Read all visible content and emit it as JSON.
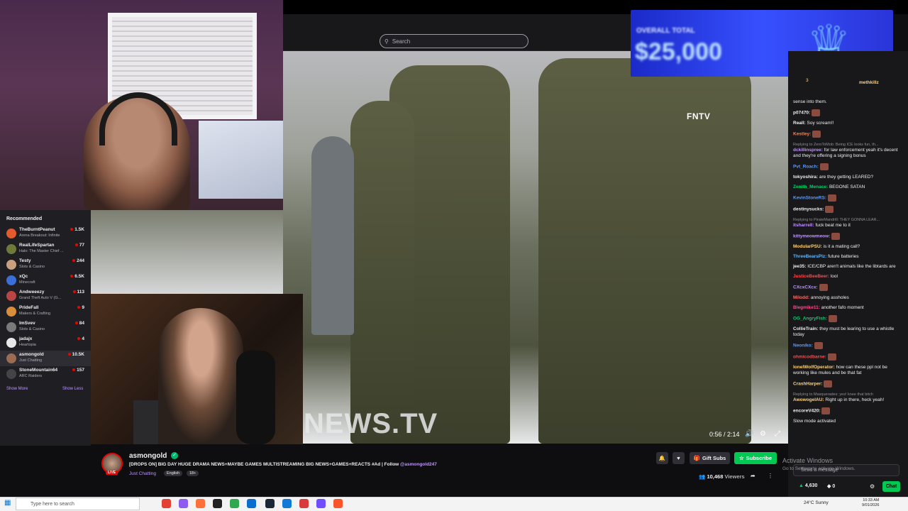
{
  "search": {
    "placeholder": "Search"
  },
  "video": {
    "watermark": "FNTV",
    "big_text": "NEWS.TV",
    "timecode": "0:56 / 2:14"
  },
  "promo": {
    "subtitle": "OVERALL TOTAL",
    "amount": "$25,000"
  },
  "sidebar": {
    "title": "Recommended",
    "channels": [
      {
        "name": "TheBurntPeanut",
        "game": "Arena Breakout: Infinite",
        "viewers": "1.5K",
        "color": "#e35b2d"
      },
      {
        "name": "RealLifeSpartan",
        "game": "Halo: The Master Chief ...",
        "viewers": "77",
        "color": "#6e7a3a"
      },
      {
        "name": "Testy",
        "game": "Slots & Casino",
        "viewers": "244",
        "color": "#c8a080"
      },
      {
        "name": "xQc",
        "game": "Minecraft",
        "viewers": "6.5K",
        "color": "#3a6fd8"
      },
      {
        "name": "Andweeezy",
        "game": "Grand Theft Auto V (G...",
        "viewers": "113",
        "color": "#bb4444"
      },
      {
        "name": "PrideFall",
        "game": "Makers & Crafting",
        "viewers": "9",
        "color": "#d98c3b"
      },
      {
        "name": "ImSvev",
        "game": "Slots & Casino",
        "viewers": "84",
        "color": "#7a7a7a"
      },
      {
        "name": "jadajx",
        "game": "Heartopia",
        "viewers": "4",
        "color": "#e8e8e8"
      },
      {
        "name": "asmongold",
        "game": "Just Chatting",
        "viewers": "10.5K",
        "color": "#9c6b53"
      },
      {
        "name": "StoneMountain64",
        "game": "ARC Raiders",
        "viewers": "157",
        "color": "#444"
      }
    ],
    "show_more": "Show More",
    "show_less": "Show Less"
  },
  "stream": {
    "name": "asmongold",
    "live": "LIVE",
    "title": "[DROPS ON] BIG DAY HUGE DRAMA NEWS+MAYBE GAMES MULTISTREAMING BIG NEWS+GAMES+REACTS #Ad | Follow ",
    "handle": "@asmongold247",
    "category": "Just Chatting",
    "tags": [
      "English",
      "18+"
    ],
    "viewers": "10,468",
    "viewers_label": "Viewers",
    "gift_label": "Gift Subs",
    "subscribe_label": "Subscribe"
  },
  "chat": {
    "top_user": "methkillz",
    "top_count": "3",
    "messages": [
      {
        "user": "",
        "text": "sense into them.",
        "color": "#efeff1"
      },
      {
        "user": "p07470:",
        "text": "",
        "color": "#efeff1",
        "emote": true
      },
      {
        "user": "Reall:",
        "text": "Soy scream!!",
        "color": "#efeff1"
      },
      {
        "user": "Kestley:",
        "text": "",
        "color": "#ff7f50",
        "emote": true
      },
      {
        "reply": "Replying to ZeroToMob: Being ICE looks fun, th...",
        "user": "dckillinspree:",
        "text": "for law enforcement yeah it's decent and they're offering a signing bonus",
        "color": "#bf94ff"
      },
      {
        "user": "Pvt_Roach:",
        "text": "",
        "color": "#5b9bff",
        "emote": true
      },
      {
        "user": "tokyoshira:",
        "text": "are they getting LEARED?",
        "color": "#efeff1"
      },
      {
        "user": "Zenith_Menace:",
        "text": "BEGONE SATAN",
        "color": "#00d26a"
      },
      {
        "user": "KevinStoneRS:",
        "text": "",
        "color": "#5b9bff",
        "emote": true
      },
      {
        "user": "destinysucks:",
        "text": "",
        "color": "#efeff1",
        "emote": true
      },
      {
        "reply": "Replying to PirateMandrill: THEY GONNA LEAR...",
        "user": "itsharrell:",
        "text": "fuck beat me to it",
        "color": "#bf94ff"
      },
      {
        "user": "kittymeowmeow:",
        "text": "",
        "color": "#bf94ff",
        "emote": true
      },
      {
        "user": "ModularPSU:",
        "text": "is it a mating call?",
        "color": "#ffd37a"
      },
      {
        "user": "ThreeBearsPlz:",
        "text": "future batteries",
        "color": "#5fb8ff"
      },
      {
        "user": "jee35:",
        "text": "ICE/CBP aren't animals like the libtards are",
        "color": "#efeff1"
      },
      {
        "user": "JusticeBeeBeer:",
        "text": "lool",
        "color": "#ff4a4a"
      },
      {
        "user": "CXcxCXcx:",
        "text": "",
        "color": "#bf94ff",
        "emote": true
      },
      {
        "user": "Milodd:",
        "text": "annoying assholes",
        "color": "#ff6b6b"
      },
      {
        "user": "Blegmike11:",
        "text": "another fafo moment",
        "color": "#ff4a8a"
      },
      {
        "user": "OG_AngryFish:",
        "text": "",
        "color": "#00d26a",
        "emote": true
      },
      {
        "user": "CollieTrain:",
        "text": "they must be learing to use a whistle today",
        "color": "#efeff1"
      },
      {
        "user": "Neoniko:",
        "text": "",
        "color": "#5b9bff",
        "emote": true
      },
      {
        "user": "ohmicodbarne:",
        "text": "",
        "color": "#ff4a4a",
        "emote": true
      },
      {
        "user": "lonelWolfOperator:",
        "text": "how can these ppl not be working like mules and be that fat",
        "color": "#ffd37a"
      },
      {
        "user": "CrashHarper:",
        "text": "",
        "color": "#ffd37a",
        "emote": true
      },
      {
        "reply": "Replying to Masquerades: yes! knee that bitch",
        "user": "AwowogelAU:",
        "text": "Right up in there, heck yeah!",
        "color": "#ffd37a"
      },
      {
        "user": "encoreV420:",
        "text": "",
        "color": "#efeff1",
        "emote": true
      },
      {
        "user": "",
        "text": "Slow mode activated",
        "color": "#8d8d94"
      }
    ],
    "input_placeholder": "Send a message",
    "points": "4,630",
    "bits": "0",
    "chat_button": "Chat"
  },
  "os": {
    "activate_title": "Activate Windows",
    "activate_sub": "Go to Settings to activate Windows.",
    "taskbar_search": "Type here to search",
    "weather": "24°C  Sunny",
    "time": "10:33 AM",
    "date": "9/01/2026"
  }
}
